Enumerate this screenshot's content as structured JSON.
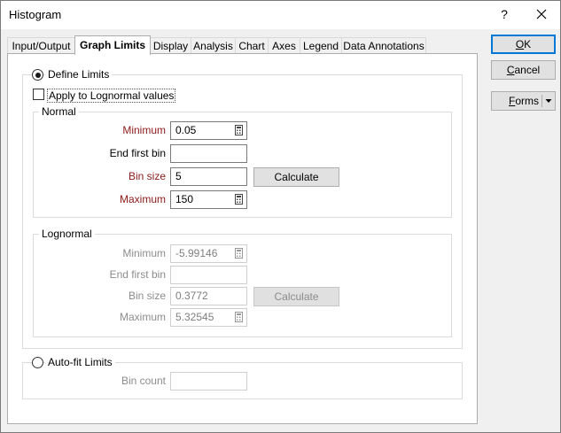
{
  "window": {
    "title": "Histogram",
    "help_label": "?"
  },
  "tabs": [
    {
      "label": "Input/Output",
      "active": false
    },
    {
      "label": "Graph Limits",
      "active": true
    },
    {
      "label": "Display",
      "active": false
    },
    {
      "label": "Analysis",
      "active": false
    },
    {
      "label": "Chart",
      "active": false
    },
    {
      "label": "Axes",
      "active": false
    },
    {
      "label": "Legend",
      "active": false
    },
    {
      "label": "Data Annotations",
      "active": false
    }
  ],
  "define_limits": {
    "label": "Define Limits",
    "selected": true
  },
  "apply_lognormal": {
    "label": "Apply to Lognormal values",
    "checked": false
  },
  "normal": {
    "title": "Normal",
    "minimum_label": "Minimum",
    "minimum": "0.05",
    "end_first_bin_label": "End first bin",
    "end_first_bin": "",
    "bin_size_label": "Bin size",
    "bin_size": "5",
    "maximum_label": "Maximum",
    "maximum": "150",
    "calculate_label": "Calculate"
  },
  "lognormal": {
    "title": "Lognormal",
    "minimum_label": "Minimum",
    "minimum": "-5.99146",
    "end_first_bin_label": "End first bin",
    "end_first_bin": "",
    "bin_size_label": "Bin size",
    "bin_size": "0.3772",
    "maximum_label": "Maximum",
    "maximum": "5.32545",
    "calculate_label": "Calculate"
  },
  "auto_fit": {
    "label": "Auto-fit Limits",
    "selected": false,
    "bin_count_label": "Bin count",
    "bin_count": ""
  },
  "buttons": {
    "ok": {
      "label": "OK",
      "underline": "O",
      "rest": "K"
    },
    "cancel": {
      "label": "Cancel",
      "underline": "C",
      "rest": "ancel"
    },
    "forms": {
      "label": "Forms",
      "underline": "F",
      "rest": "orms"
    }
  }
}
